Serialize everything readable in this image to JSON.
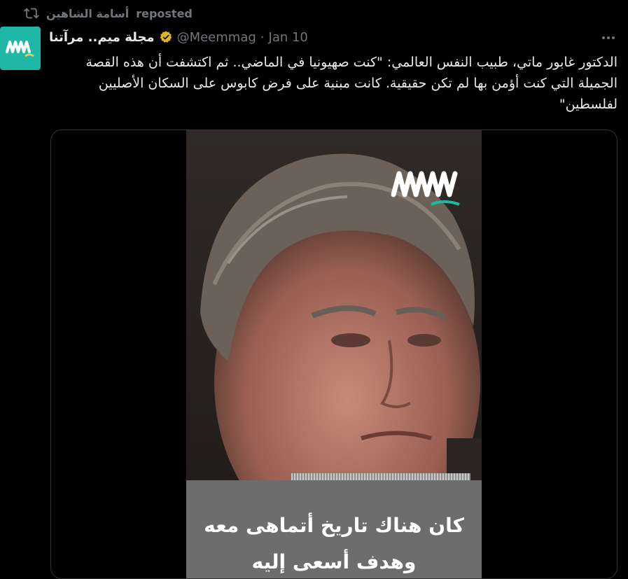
{
  "repost": {
    "user": "أسامة الشاهين",
    "label": "reposted"
  },
  "tweet": {
    "author_name": "مجلة ميم.. مرآتنا",
    "handle": "@Meemmag",
    "separator": "·",
    "date": "Jan 10",
    "text": "الدكتور غابور ماتي، طبيب النفس العالمي: \"كنت صهيونيا في الماضي.. ثم اكتشفت أن هذه القصة الجميلة التي كنت أؤمن بها لم تكن حقيقية. كانت مبنية على فرض كابوس على السكان الأصليين لفلسطين\""
  },
  "media": {
    "caption_line1": "كان هناك تاريخ أتماهى معه",
    "caption_line2": "وهدف أسعى إليه"
  },
  "colors": {
    "background": "#000000",
    "text": "#e7e9ea",
    "muted": "#71767b",
    "avatar_bg": "#1fb7a6",
    "verified_gold": "#e2b719"
  },
  "icons": {
    "repost": "repost-icon",
    "verified": "verified-badge-icon",
    "more": "more-icon",
    "logo": "meem-logo"
  }
}
